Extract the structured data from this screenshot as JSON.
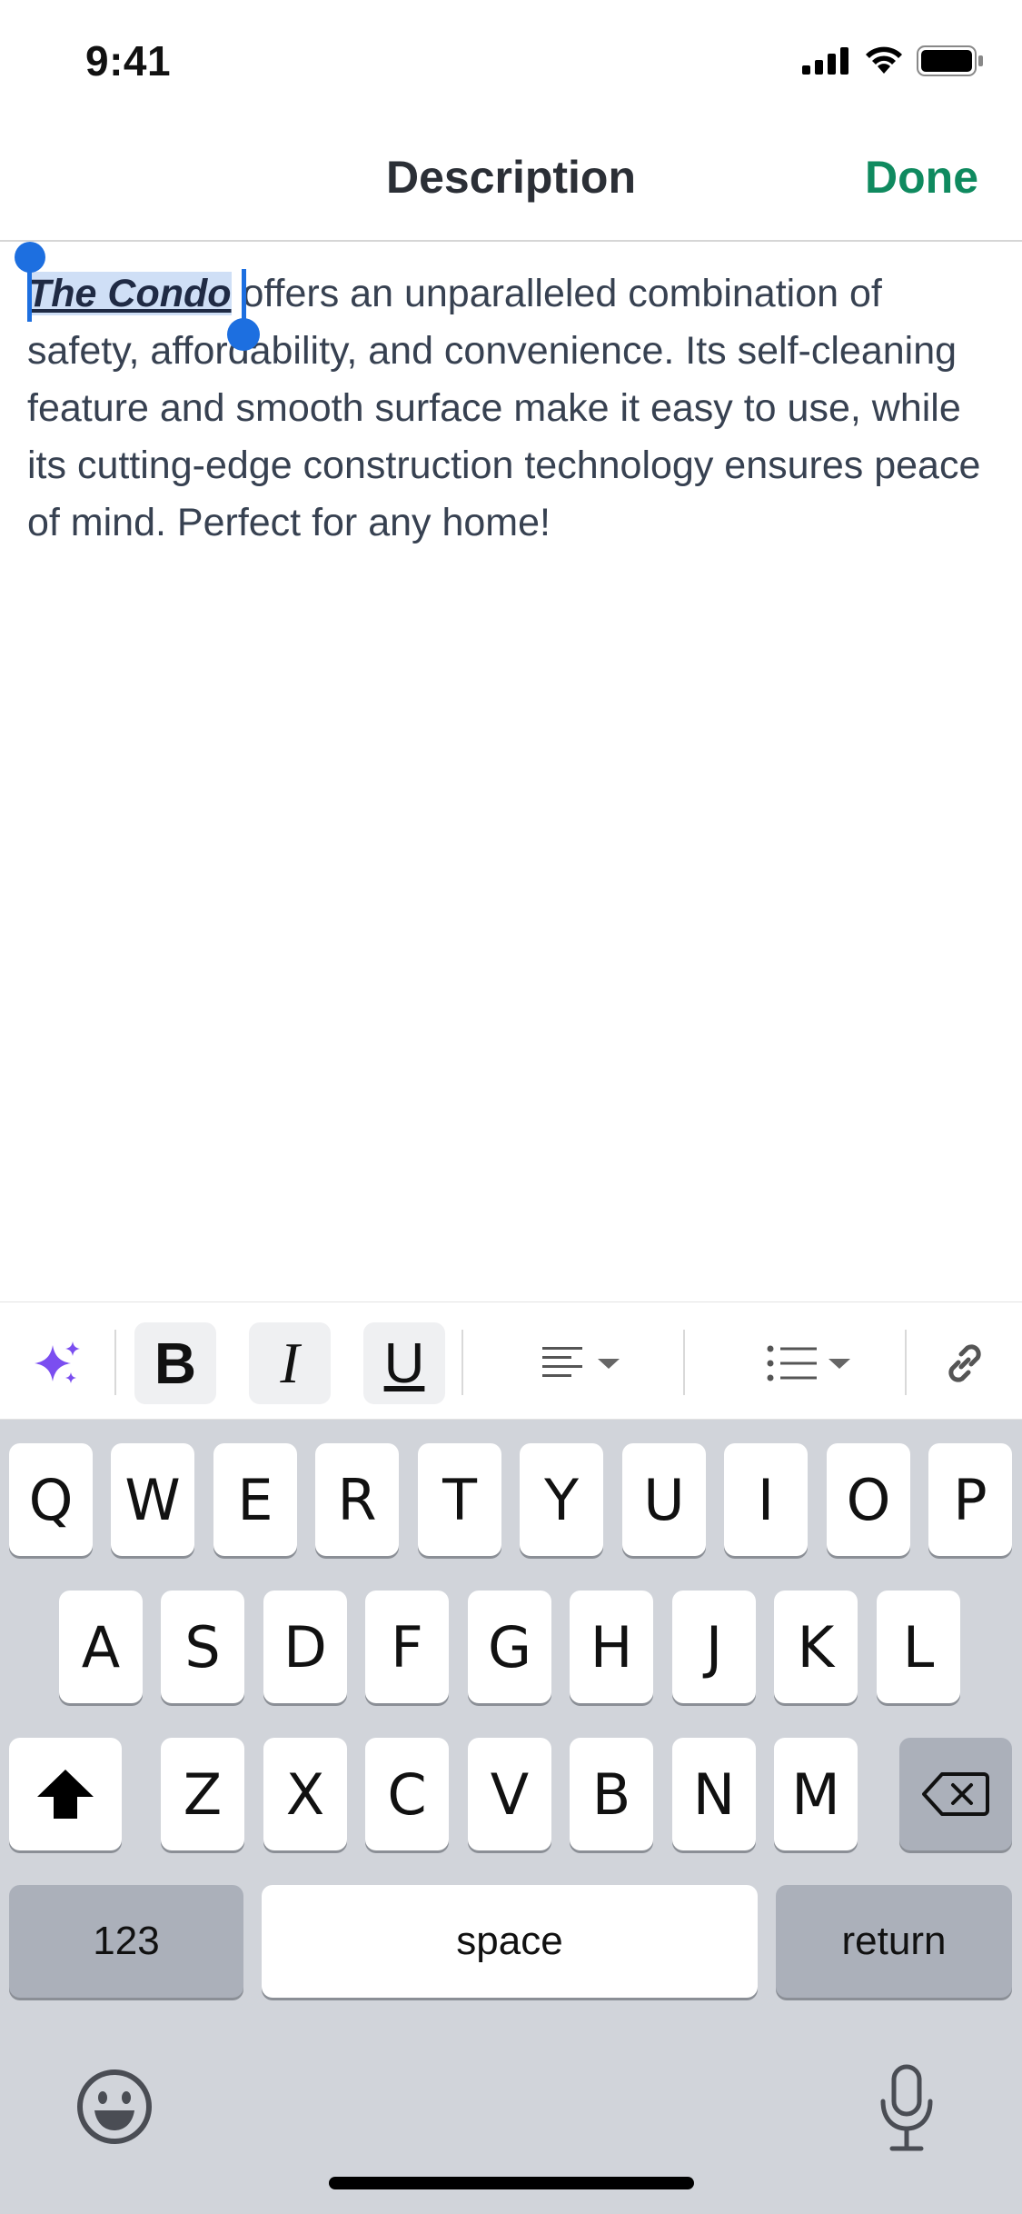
{
  "status_bar": {
    "time": "9:41"
  },
  "nav": {
    "title": "Description",
    "done_label": "Done"
  },
  "editor": {
    "selected_text": "The Condo",
    "rest_text": " offers an unparalleled combination of safety, affordability, and convenience. Its self-cleaning feature and smooth surface make it easy to use, while its cutting-edge construction technology ensures peace of mind. Perfect for any home!"
  },
  "toolbar": {
    "bold_label": "B",
    "italic_label": "I",
    "underline_label": "U",
    "icons": [
      "sparkles-icon",
      "align-left-icon",
      "bullet-list-icon",
      "link-icon"
    ],
    "accent_color": "#7b4ef0"
  },
  "keyboard": {
    "row1": [
      "Q",
      "W",
      "E",
      "R",
      "T",
      "Y",
      "U",
      "I",
      "O",
      "P"
    ],
    "row2": [
      "A",
      "S",
      "D",
      "F",
      "G",
      "H",
      "J",
      "K",
      "L"
    ],
    "row3": [
      "Z",
      "X",
      "C",
      "V",
      "B",
      "N",
      "M"
    ],
    "numbers_label": "123",
    "space_label": "space",
    "return_label": "return"
  },
  "colors": {
    "done": "#0f8a5f",
    "selection": "#cfdff6",
    "cursor": "#1d6fe0",
    "keyboard_bg": "#d1d4da"
  }
}
